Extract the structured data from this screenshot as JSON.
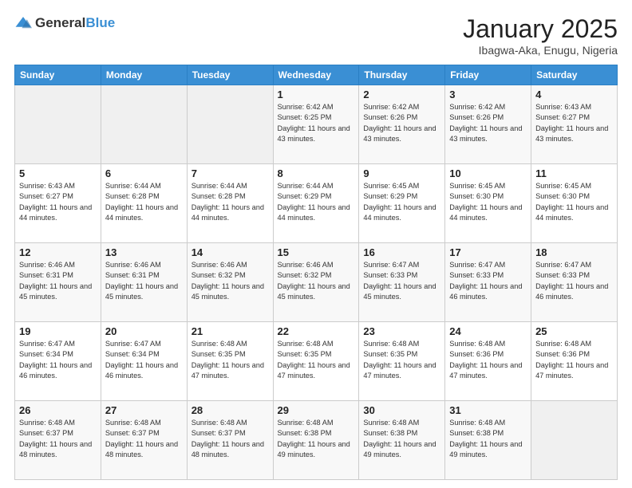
{
  "header": {
    "logo_general": "General",
    "logo_blue": "Blue",
    "month_year": "January 2025",
    "location": "Ibagwa-Aka, Enugu, Nigeria"
  },
  "days_of_week": [
    "Sunday",
    "Monday",
    "Tuesday",
    "Wednesday",
    "Thursday",
    "Friday",
    "Saturday"
  ],
  "weeks": [
    [
      {
        "day": "",
        "info": ""
      },
      {
        "day": "",
        "info": ""
      },
      {
        "day": "",
        "info": ""
      },
      {
        "day": "1",
        "info": "Sunrise: 6:42 AM\nSunset: 6:25 PM\nDaylight: 11 hours and 43 minutes."
      },
      {
        "day": "2",
        "info": "Sunrise: 6:42 AM\nSunset: 6:26 PM\nDaylight: 11 hours and 43 minutes."
      },
      {
        "day": "3",
        "info": "Sunrise: 6:42 AM\nSunset: 6:26 PM\nDaylight: 11 hours and 43 minutes."
      },
      {
        "day": "4",
        "info": "Sunrise: 6:43 AM\nSunset: 6:27 PM\nDaylight: 11 hours and 43 minutes."
      }
    ],
    [
      {
        "day": "5",
        "info": "Sunrise: 6:43 AM\nSunset: 6:27 PM\nDaylight: 11 hours and 44 minutes."
      },
      {
        "day": "6",
        "info": "Sunrise: 6:44 AM\nSunset: 6:28 PM\nDaylight: 11 hours and 44 minutes."
      },
      {
        "day": "7",
        "info": "Sunrise: 6:44 AM\nSunset: 6:28 PM\nDaylight: 11 hours and 44 minutes."
      },
      {
        "day": "8",
        "info": "Sunrise: 6:44 AM\nSunset: 6:29 PM\nDaylight: 11 hours and 44 minutes."
      },
      {
        "day": "9",
        "info": "Sunrise: 6:45 AM\nSunset: 6:29 PM\nDaylight: 11 hours and 44 minutes."
      },
      {
        "day": "10",
        "info": "Sunrise: 6:45 AM\nSunset: 6:30 PM\nDaylight: 11 hours and 44 minutes."
      },
      {
        "day": "11",
        "info": "Sunrise: 6:45 AM\nSunset: 6:30 PM\nDaylight: 11 hours and 44 minutes."
      }
    ],
    [
      {
        "day": "12",
        "info": "Sunrise: 6:46 AM\nSunset: 6:31 PM\nDaylight: 11 hours and 45 minutes."
      },
      {
        "day": "13",
        "info": "Sunrise: 6:46 AM\nSunset: 6:31 PM\nDaylight: 11 hours and 45 minutes."
      },
      {
        "day": "14",
        "info": "Sunrise: 6:46 AM\nSunset: 6:32 PM\nDaylight: 11 hours and 45 minutes."
      },
      {
        "day": "15",
        "info": "Sunrise: 6:46 AM\nSunset: 6:32 PM\nDaylight: 11 hours and 45 minutes."
      },
      {
        "day": "16",
        "info": "Sunrise: 6:47 AM\nSunset: 6:33 PM\nDaylight: 11 hours and 45 minutes."
      },
      {
        "day": "17",
        "info": "Sunrise: 6:47 AM\nSunset: 6:33 PM\nDaylight: 11 hours and 46 minutes."
      },
      {
        "day": "18",
        "info": "Sunrise: 6:47 AM\nSunset: 6:33 PM\nDaylight: 11 hours and 46 minutes."
      }
    ],
    [
      {
        "day": "19",
        "info": "Sunrise: 6:47 AM\nSunset: 6:34 PM\nDaylight: 11 hours and 46 minutes."
      },
      {
        "day": "20",
        "info": "Sunrise: 6:47 AM\nSunset: 6:34 PM\nDaylight: 11 hours and 46 minutes."
      },
      {
        "day": "21",
        "info": "Sunrise: 6:48 AM\nSunset: 6:35 PM\nDaylight: 11 hours and 47 minutes."
      },
      {
        "day": "22",
        "info": "Sunrise: 6:48 AM\nSunset: 6:35 PM\nDaylight: 11 hours and 47 minutes."
      },
      {
        "day": "23",
        "info": "Sunrise: 6:48 AM\nSunset: 6:35 PM\nDaylight: 11 hours and 47 minutes."
      },
      {
        "day": "24",
        "info": "Sunrise: 6:48 AM\nSunset: 6:36 PM\nDaylight: 11 hours and 47 minutes."
      },
      {
        "day": "25",
        "info": "Sunrise: 6:48 AM\nSunset: 6:36 PM\nDaylight: 11 hours and 47 minutes."
      }
    ],
    [
      {
        "day": "26",
        "info": "Sunrise: 6:48 AM\nSunset: 6:37 PM\nDaylight: 11 hours and 48 minutes."
      },
      {
        "day": "27",
        "info": "Sunrise: 6:48 AM\nSunset: 6:37 PM\nDaylight: 11 hours and 48 minutes."
      },
      {
        "day": "28",
        "info": "Sunrise: 6:48 AM\nSunset: 6:37 PM\nDaylight: 11 hours and 48 minutes."
      },
      {
        "day": "29",
        "info": "Sunrise: 6:48 AM\nSunset: 6:38 PM\nDaylight: 11 hours and 49 minutes."
      },
      {
        "day": "30",
        "info": "Sunrise: 6:48 AM\nSunset: 6:38 PM\nDaylight: 11 hours and 49 minutes."
      },
      {
        "day": "31",
        "info": "Sunrise: 6:48 AM\nSunset: 6:38 PM\nDaylight: 11 hours and 49 minutes."
      },
      {
        "day": "",
        "info": ""
      }
    ]
  ]
}
